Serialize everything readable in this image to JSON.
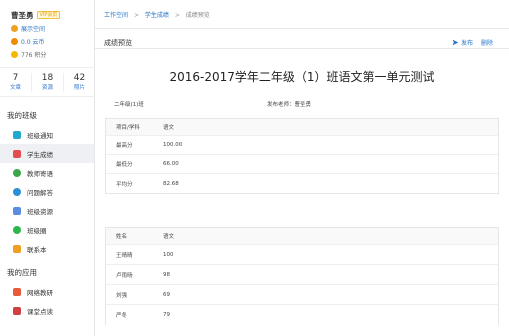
{
  "user": {
    "name": "曹圣勇",
    "vip": "VIP会员",
    "space_link": "展示空间",
    "coins": "0.0 云币",
    "points": "776 积分"
  },
  "stats": [
    {
      "num": "7",
      "label": "文章"
    },
    {
      "num": "18",
      "label": "资源"
    },
    {
      "num": "42",
      "label": "照片"
    }
  ],
  "sidebar": {
    "class_title": "我的班级",
    "items": [
      {
        "label": "班级通知",
        "color": "#22a8c9"
      },
      {
        "label": "学生成绩",
        "color": "#e44d4d"
      },
      {
        "label": "教师寄语",
        "color": "#3aa84a"
      },
      {
        "label": "问题解答",
        "color": "#2a8fd6"
      },
      {
        "label": "班级资源",
        "color": "#5a8fe0"
      },
      {
        "label": "班级圈",
        "color": "#2ab84a"
      },
      {
        "label": "联系本",
        "color": "#f0a020"
      }
    ],
    "apps_title": "我的应用",
    "apps": [
      {
        "label": "网络教研",
        "color": "#e85a3a"
      },
      {
        "label": "课堂点读",
        "color": "#d04040"
      }
    ]
  },
  "breadcrumb": {
    "a": "工作空间",
    "b": "学生成绩",
    "c": "成绩预览",
    "sep": ">"
  },
  "page": {
    "heading": "成绩预览",
    "publish": "发布",
    "delete": "删除",
    "title": "2016-2017学年二年级（1）班语文第一单元测试",
    "class_name": "二年级(1)班",
    "teacher": "发布老师：曹圣勇"
  },
  "summary": {
    "headers": [
      "项目/学科",
      "语文"
    ],
    "rows": [
      [
        "最高分",
        "100.00"
      ],
      [
        "最低分",
        "66.00"
      ],
      [
        "平均分",
        "82.68"
      ]
    ]
  },
  "students": {
    "headers": [
      "姓名",
      "语文"
    ],
    "rows": [
      [
        "王晴晴",
        "100"
      ],
      [
        "卢雨旸",
        "98"
      ],
      [
        "刘强",
        "69"
      ],
      [
        "严冬",
        "79"
      ]
    ]
  }
}
